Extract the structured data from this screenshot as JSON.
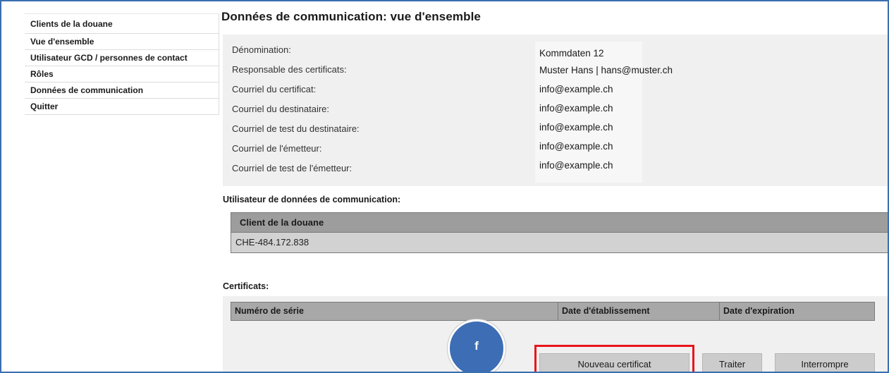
{
  "sidebar": {
    "items": [
      {
        "label": "Clients de la douane"
      },
      {
        "label": "Vue d'ensemble"
      },
      {
        "label": "Utilisateur GCD / personnes de contact"
      },
      {
        "label": "Rôles"
      },
      {
        "label": "Données de communication"
      },
      {
        "label": "Quitter"
      }
    ]
  },
  "page": {
    "title": "Données de communication: vue d'ensemble"
  },
  "details": {
    "fields": [
      {
        "label": "Dénomination:",
        "value": "Kommdaten 12"
      },
      {
        "label": "Responsable des certificats:",
        "value": "Muster Hans | hans@muster.ch"
      },
      {
        "label": "Courriel du certificat:",
        "value": "info@example.ch"
      },
      {
        "label": "Courriel du destinataire:",
        "value": "info@example.ch"
      },
      {
        "label": "Courriel de test du destinataire:",
        "value": "info@example.ch"
      },
      {
        "label": "Courriel de l'émetteur:",
        "value": "info@example.ch"
      },
      {
        "label": "Courriel de test de l'émetteur:",
        "value": "info@example.ch"
      }
    ]
  },
  "comm_users": {
    "heading": "Utilisateur de données de communication:",
    "column_header": "Client de la douane",
    "rows": [
      "CHE-484.172.838"
    ]
  },
  "certificates": {
    "heading": "Certificats:",
    "columns": [
      "Numéro de série",
      "Date d'établissement",
      "Date d'expiration"
    ]
  },
  "buttons": {
    "new_certificate": "Nouveau certificat",
    "edit": "Traiter",
    "cancel": "Interrompre"
  },
  "marker": {
    "label": "f",
    "color": "#3d6db5"
  },
  "colors": {
    "highlight": "#e8141b",
    "frame": "#3a6fb0"
  }
}
